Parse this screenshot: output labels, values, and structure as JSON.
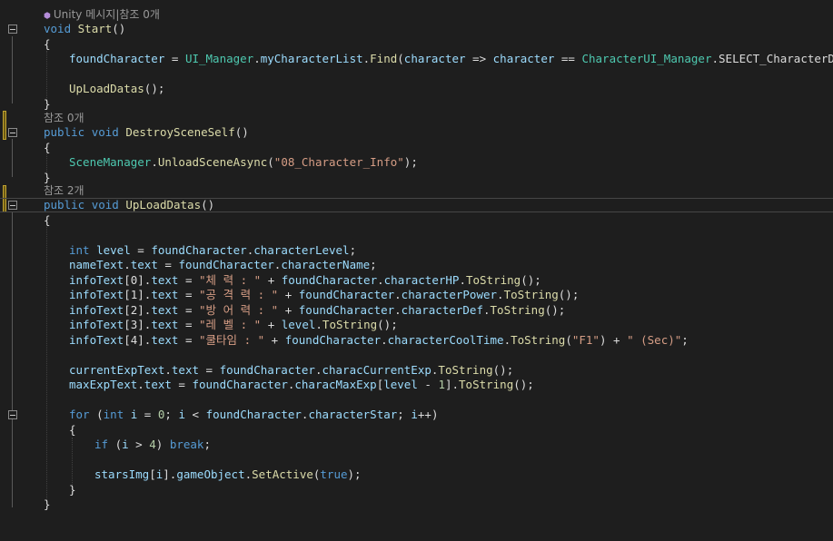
{
  "codelens": {
    "unity_label": "Unity 메시지|참조 0개",
    "ref0": "참조 0개",
    "ref2": "참조 2개"
  },
  "code": {
    "l2": [
      "void",
      "Start",
      "()"
    ],
    "l3": "{",
    "l4": [
      "foundCharacter",
      " = ",
      "UI_Manager",
      ".",
      "myCharacterList",
      ".",
      "Find",
      "(",
      "character",
      " => ",
      "character",
      " == ",
      "CharacterUI_Manager",
      ".",
      "SELECT_CharacterData",
      ");"
    ],
    "l6": [
      "UpLoadDatas",
      "();"
    ],
    "l7": "}",
    "l9": [
      "public",
      "void",
      "DestroySceneSelf",
      "()"
    ],
    "l10": "{",
    "l11": [
      "SceneManager",
      ".",
      "UnloadSceneAsync",
      "(",
      "\"08_Character_Info\"",
      ");"
    ],
    "l12": "}",
    "l14": [
      "public",
      "void",
      "UpLoadDatas",
      "()"
    ],
    "l15": "{",
    "l17": [
      "int",
      "level",
      " = ",
      "foundCharacter",
      ".",
      "characterLevel",
      ";"
    ],
    "l18": [
      "nameText",
      ".",
      "text",
      " = ",
      "foundCharacter",
      ".",
      "characterName",
      ";"
    ],
    "l19": [
      "infoText",
      "[0].",
      "text",
      " = ",
      "\"체 력 : \"",
      " + ",
      "foundCharacter",
      ".",
      "characterHP",
      ".",
      "ToString",
      "();"
    ],
    "l20": [
      "infoText",
      "[1].",
      "text",
      " = ",
      "\"공 격 력 : \"",
      " + ",
      "foundCharacter",
      ".",
      "characterPower",
      ".",
      "ToString",
      "();"
    ],
    "l21": [
      "infoText",
      "[2].",
      "text",
      " = ",
      "\"방 어 력 : \"",
      " + ",
      "foundCharacter",
      ".",
      "characterDef",
      ".",
      "ToString",
      "();"
    ],
    "l22": [
      "infoText",
      "[3].",
      "text",
      " = ",
      "\"레 벨 : \"",
      " + ",
      "level",
      ".",
      "ToString",
      "();"
    ],
    "l23": [
      "infoText",
      "[4].",
      "text",
      " = ",
      "\"쿨타임 : \"",
      " + ",
      "foundCharacter",
      ".",
      "characterCoolTime",
      ".",
      "ToString",
      "(",
      "\"F1\"",
      ") + ",
      "\" (Sec)\"",
      ";"
    ],
    "l25": [
      "currentExpText",
      ".",
      "text",
      " = ",
      "foundCharacter",
      ".",
      "characCurrentExp",
      ".",
      "ToString",
      "();"
    ],
    "l26": [
      "maxExpText",
      ".",
      "text",
      " = ",
      "foundCharacter",
      ".",
      "characMaxExp",
      "[",
      "level",
      " - ",
      "1",
      "].",
      "ToString",
      "();"
    ],
    "l28": [
      "for",
      " (",
      "int",
      "i",
      " = ",
      "0",
      "; ",
      "i",
      " < ",
      "foundCharacter",
      ".",
      "characterStar",
      "; ",
      "i",
      "++)"
    ],
    "l29": "{",
    "l30": [
      "if",
      " (",
      "i",
      " > ",
      "4",
      ") ",
      "break",
      ";"
    ],
    "l32": [
      "starsImg",
      "[",
      "i",
      "].",
      "gameObject",
      ".",
      "SetActive",
      "(",
      "true",
      ");"
    ],
    "l33": "}",
    "l34": "}"
  },
  "colors": {
    "background": "#1e1e1e",
    "keyword": "#569cd6",
    "type": "#4ec9b0",
    "method": "#dcdcaa",
    "identifier": "#9cdcfe",
    "string": "#d69d85",
    "number": "#b5cea8"
  }
}
